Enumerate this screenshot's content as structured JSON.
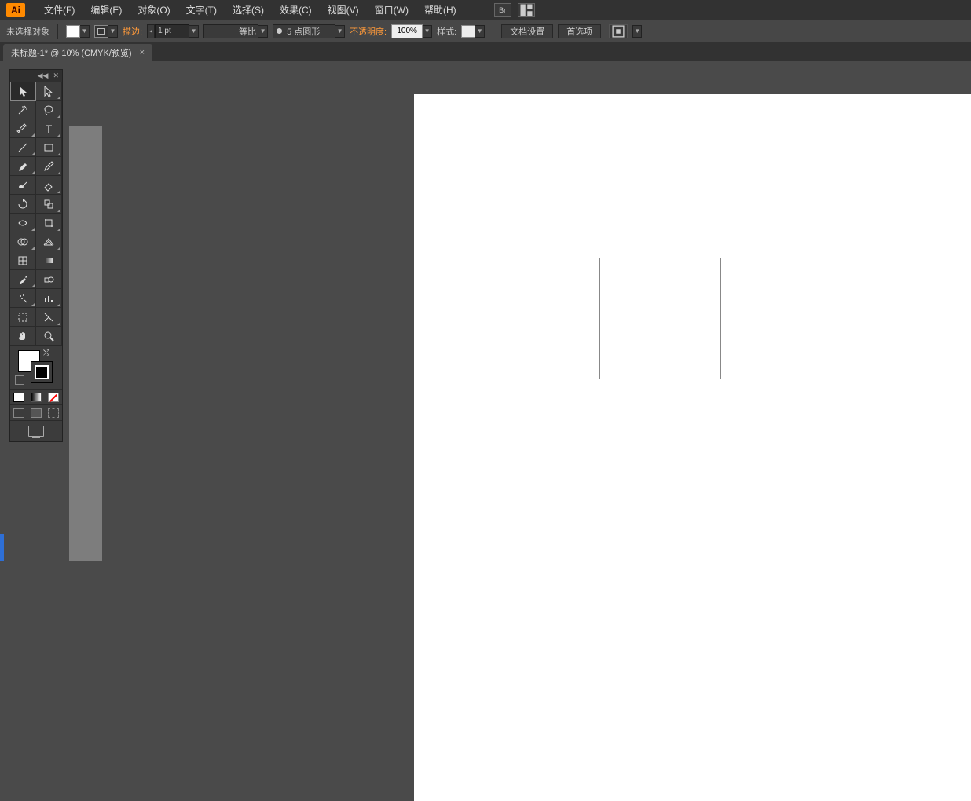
{
  "app": {
    "logo": "Ai"
  },
  "menu": {
    "file": "文件(F)",
    "edit": "编辑(E)",
    "object": "对象(O)",
    "type": "文字(T)",
    "select": "选择(S)",
    "effect": "效果(C)",
    "view": "视图(V)",
    "window": "窗口(W)",
    "help": "帮助(H)"
  },
  "control": {
    "selection_status": "未选择对象",
    "stroke_label": "描边:",
    "stroke_weight": "1 pt",
    "profile_label": "等比",
    "brush_label": "5 点圆形",
    "opacity_label": "不透明度:",
    "opacity_value": "100%",
    "style_label": "样式:",
    "doc_setup": "文档设置",
    "preferences": "首选项"
  },
  "tab": {
    "title": "未标题-1* @ 10% (CMYK/预览)",
    "close": "×"
  },
  "tools": {
    "names": [
      "selection-tool",
      "direct-selection-tool",
      "magic-wand-tool",
      "lasso-tool",
      "pen-tool",
      "type-tool",
      "line-segment-tool",
      "rectangle-tool",
      "paintbrush-tool",
      "pencil-tool",
      "blob-brush-tool",
      "eraser-tool",
      "rotate-tool",
      "scale-tool",
      "width-tool",
      "free-transform-tool",
      "shape-builder-tool",
      "perspective-grid-tool",
      "mesh-tool",
      "gradient-tool",
      "eyedropper-tool",
      "blend-tool",
      "symbol-sprayer-tool",
      "column-graph-tool",
      "artboard-tool",
      "slice-tool",
      "hand-tool",
      "zoom-tool"
    ]
  },
  "colors": {
    "fill": "#ffffff",
    "stroke": "#000000",
    "accent": "#ff8a00"
  }
}
